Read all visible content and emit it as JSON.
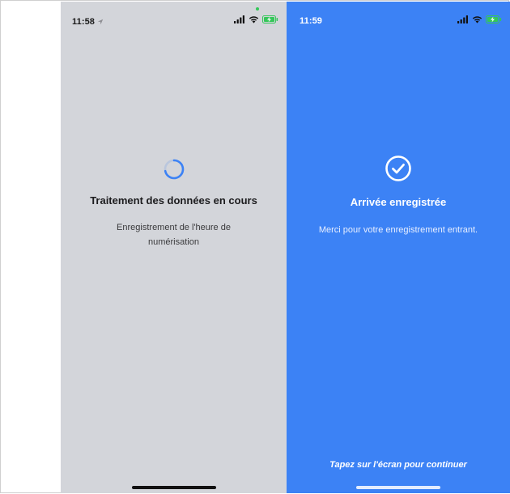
{
  "left_screen": {
    "status_time": "11:58",
    "title": "Traitement des données en cours",
    "subtitle": "Enregistrement de l'heure de numérisation",
    "colors": {
      "background": "#d3d5da",
      "spinner": "#3c82f5"
    }
  },
  "right_screen": {
    "status_time": "11:59",
    "title": "Arrivée enregistrée",
    "subtitle": "Merci pour votre enregistrement entrant.",
    "hint": "Tapez sur l'écran pour continuer",
    "colors": {
      "background": "#3c82f5",
      "foreground": "#ffffff"
    }
  },
  "icons": {
    "spinner": "loading-spinner-icon",
    "check": "checkmark-circle-icon",
    "signal": "cellular-signal-icon",
    "wifi": "wifi-icon",
    "battery": "battery-charging-icon",
    "location": "location-arrow-icon"
  }
}
